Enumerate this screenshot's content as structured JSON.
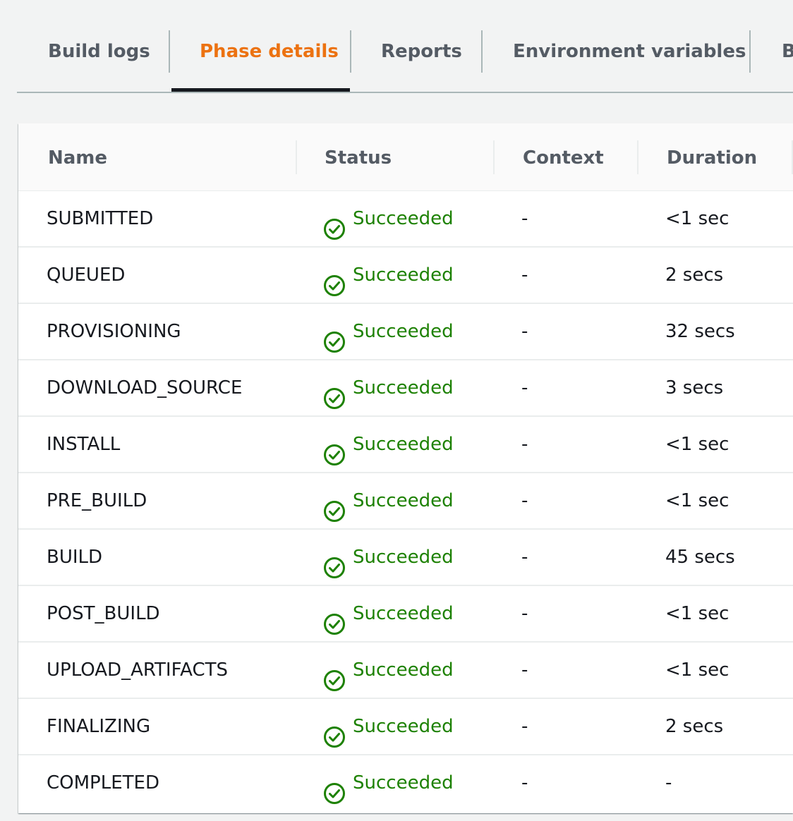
{
  "tabs": [
    {
      "label": "Build logs",
      "active": false
    },
    {
      "label": "Phase details",
      "active": true
    },
    {
      "label": "Reports",
      "active": false
    },
    {
      "label": "Environment variables",
      "active": false
    }
  ],
  "tab_overflow_label": "B",
  "colors": {
    "active_tab": "#ec7211",
    "success": "#1d8102",
    "text": "#16191f",
    "header_text": "#545b64"
  },
  "table": {
    "columns": [
      "Name",
      "Status",
      "Context",
      "Duration"
    ],
    "rows": [
      {
        "name": "SUBMITTED",
        "status": "Succeeded",
        "status_icon": "check-circle-icon",
        "context": "-",
        "duration": "<1 sec"
      },
      {
        "name": "QUEUED",
        "status": "Succeeded",
        "status_icon": "check-circle-icon",
        "context": "-",
        "duration": "2 secs"
      },
      {
        "name": "PROVISIONING",
        "status": "Succeeded",
        "status_icon": "check-circle-icon",
        "context": "-",
        "duration": "32 secs"
      },
      {
        "name": "DOWNLOAD_SOURCE",
        "status": "Succeeded",
        "status_icon": "check-circle-icon",
        "context": "-",
        "duration": "3 secs"
      },
      {
        "name": "INSTALL",
        "status": "Succeeded",
        "status_icon": "check-circle-icon",
        "context": "-",
        "duration": "<1 sec"
      },
      {
        "name": "PRE_BUILD",
        "status": "Succeeded",
        "status_icon": "check-circle-icon",
        "context": "-",
        "duration": "<1 sec"
      },
      {
        "name": "BUILD",
        "status": "Succeeded",
        "status_icon": "check-circle-icon",
        "context": "-",
        "duration": "45 secs"
      },
      {
        "name": "POST_BUILD",
        "status": "Succeeded",
        "status_icon": "check-circle-icon",
        "context": "-",
        "duration": "<1 sec"
      },
      {
        "name": "UPLOAD_ARTIFACTS",
        "status": "Succeeded",
        "status_icon": "check-circle-icon",
        "context": "-",
        "duration": "<1 sec"
      },
      {
        "name": "FINALIZING",
        "status": "Succeeded",
        "status_icon": "check-circle-icon",
        "context": "-",
        "duration": "2 secs"
      },
      {
        "name": "COMPLETED",
        "status": "Succeeded",
        "status_icon": "check-circle-icon",
        "context": "-",
        "duration": "-"
      }
    ]
  }
}
